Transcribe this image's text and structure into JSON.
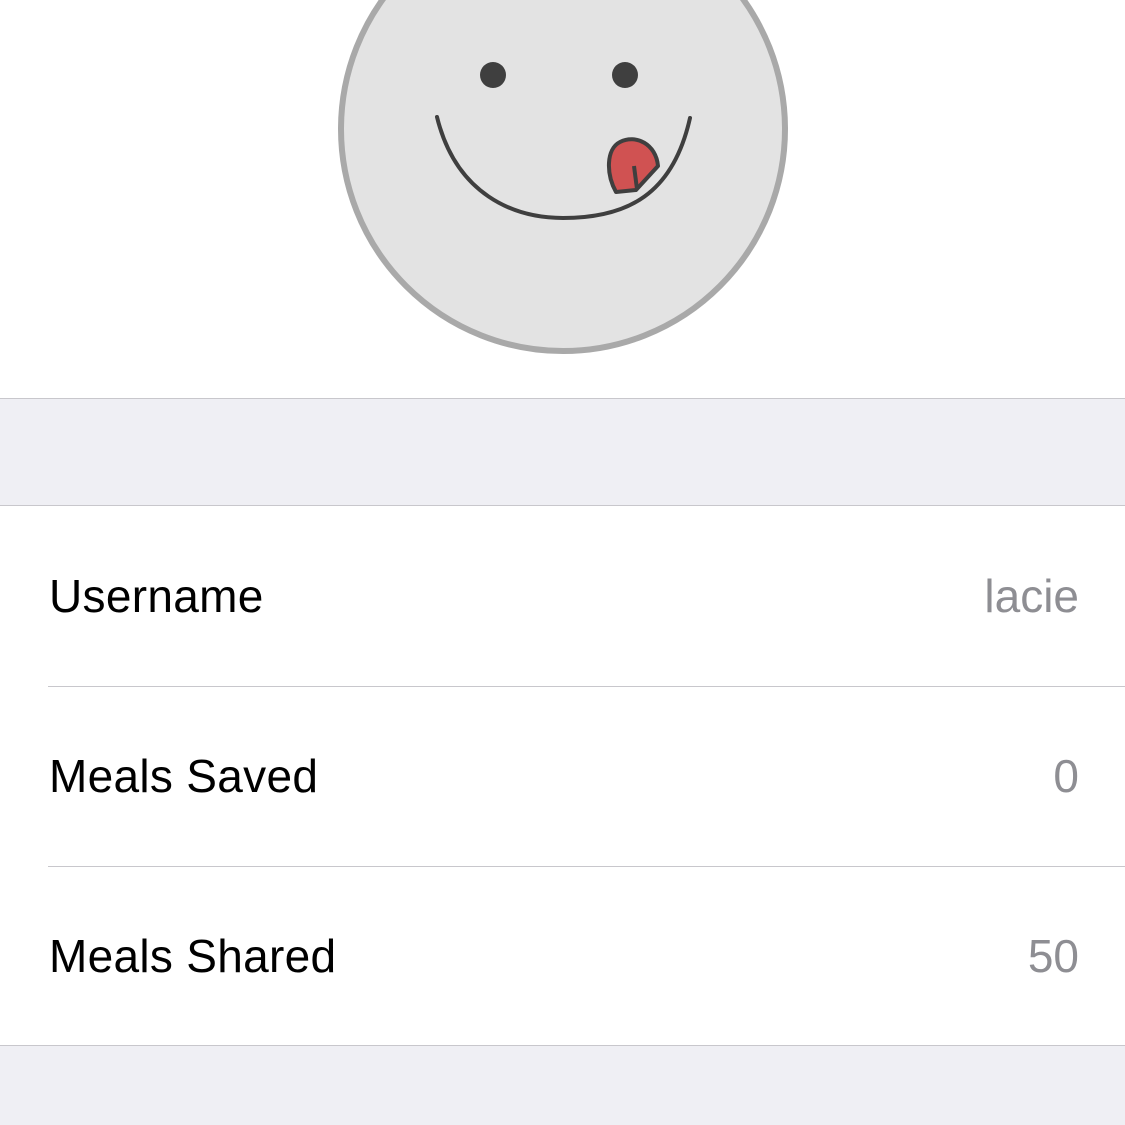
{
  "avatar": {
    "icon": "smiley-tongue-icon"
  },
  "profile": {
    "rows": [
      {
        "label": "Username",
        "value": "lacie"
      },
      {
        "label": "Meals Saved",
        "value": "0"
      },
      {
        "label": "Meals Shared",
        "value": "50"
      }
    ]
  },
  "colors": {
    "background_grouped": "#efeff4",
    "separator": "#c8c7cc",
    "secondary_text": "#8e8e93",
    "avatar_fill": "#e3e3e3",
    "avatar_border": "#a9a9a9",
    "tongue": "#d05252"
  }
}
